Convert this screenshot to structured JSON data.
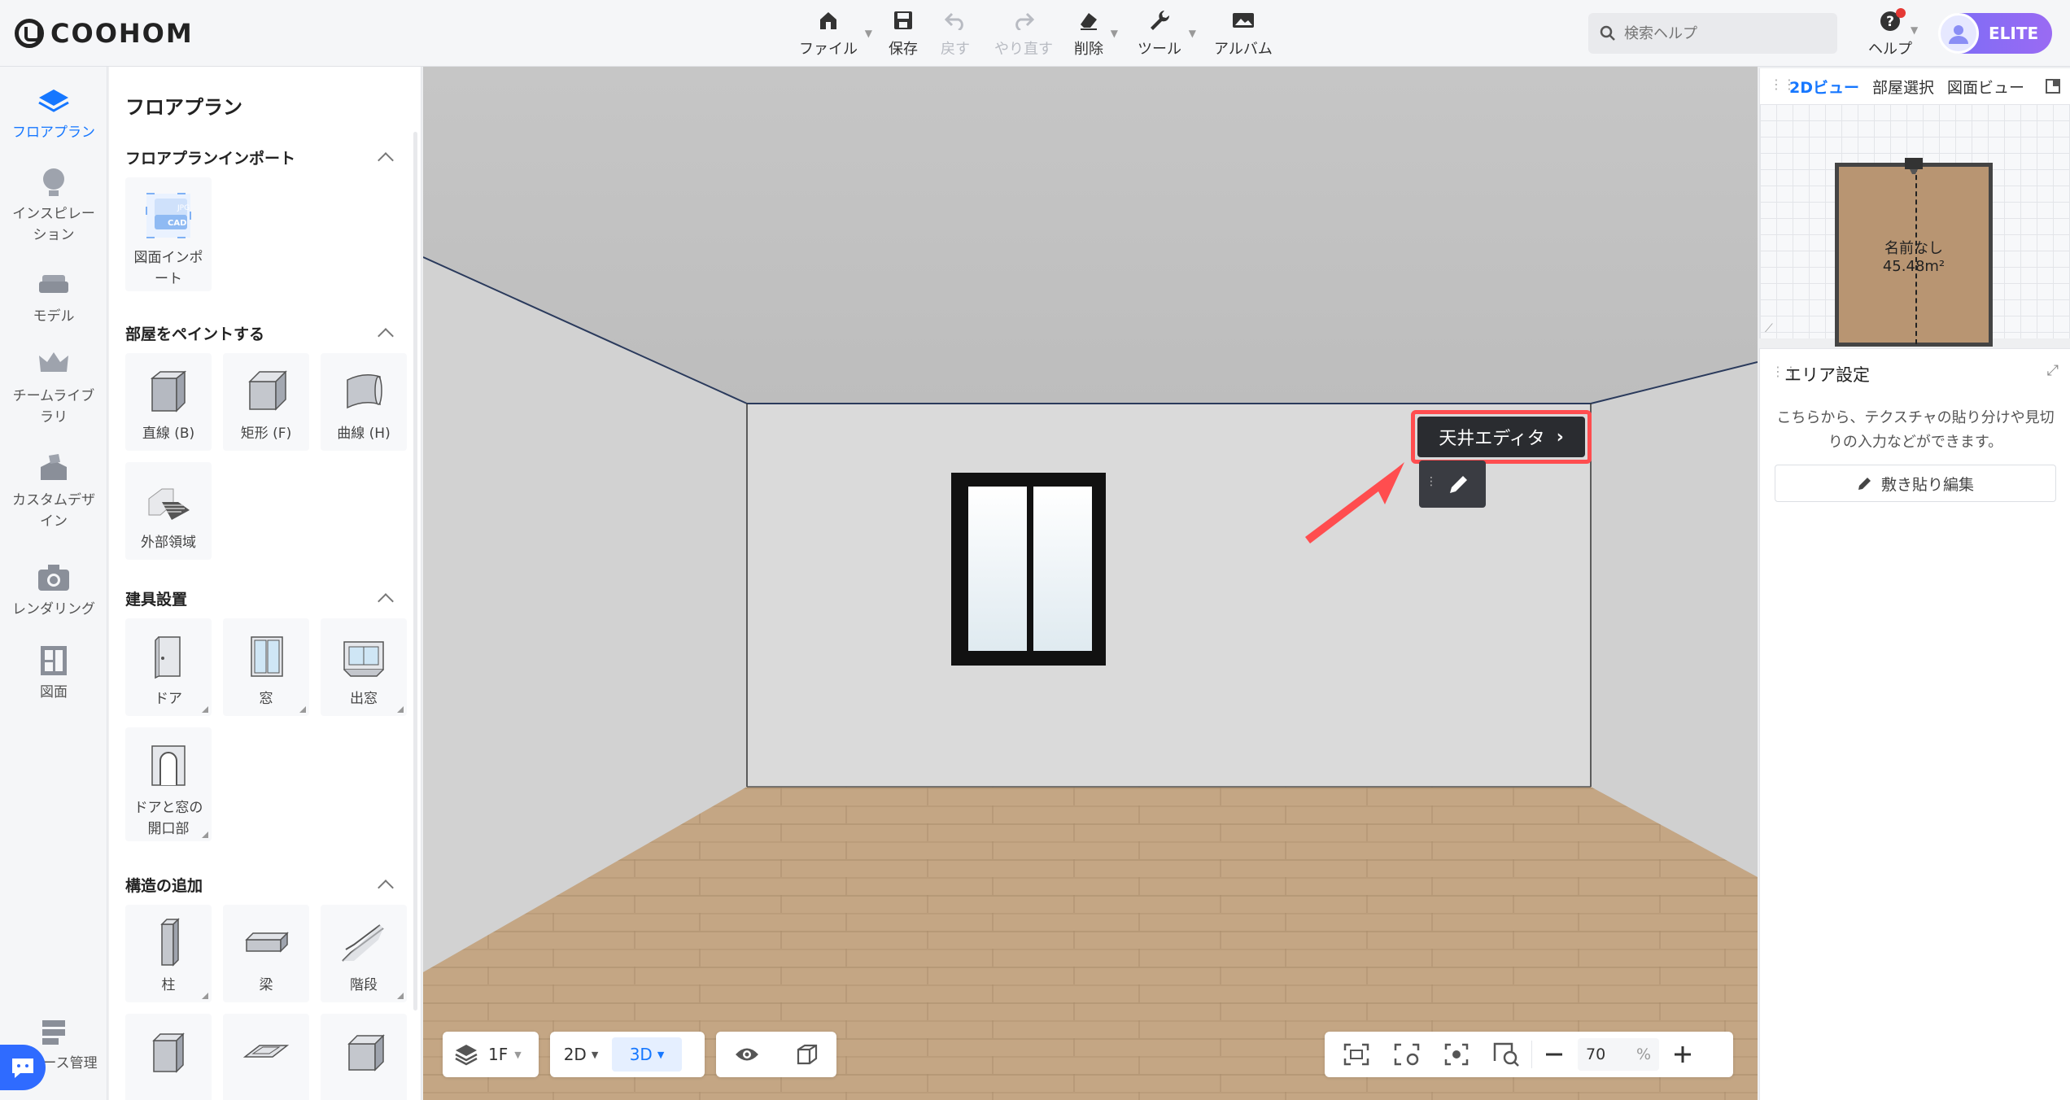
{
  "app": {
    "logo_text": "COOHOM"
  },
  "toolbar": {
    "file": "ファイル",
    "save": "保存",
    "undo": "戻す",
    "redo": "やり直す",
    "delete": "削除",
    "tools": "ツール",
    "album": "アルバム"
  },
  "search": {
    "placeholder": "検索ヘルプ"
  },
  "help": {
    "label": "ヘルプ"
  },
  "account": {
    "badge": "ELITE"
  },
  "rail": {
    "floorplan": "フロアプラン",
    "inspiration": "インスピレーション",
    "model": "モデル",
    "team_library": "チームライブラリ",
    "custom_design": "カスタムデザイン",
    "rendering": "レンダリング",
    "drawing": "図面",
    "resource_mgmt": "ース管理"
  },
  "panel": {
    "title": "フロアプラン",
    "import_section": "フロアプランインポート",
    "import_card": "図面インポート",
    "import_badges": [
      "JPG",
      "CAD"
    ],
    "paint_section": "部屋をペイントする",
    "paint_items": [
      "直線 (B)",
      "矩形 (F)",
      "曲線 (H)",
      "外部領域"
    ],
    "fixtures_section": "建具設置",
    "fixtures_items": [
      "ドア",
      "窓",
      "出窓",
      "ドアと窓の開口部"
    ],
    "structure_section": "構造の追加",
    "structure_items": [
      "柱",
      "梁",
      "階段"
    ]
  },
  "viewport": {
    "ceiling_editor_label": "天井エディタ",
    "floor_select": "1F",
    "view_2d": "2D",
    "view_3d": "3D",
    "zoom_value": "70",
    "zoom_unit": "%"
  },
  "minimap": {
    "tab_2d": "2Dビュー",
    "tab_room": "部屋選択",
    "tab_drawing": "図面ビュー",
    "room_name": "名前なし",
    "room_area": "45.48m²"
  },
  "area_settings": {
    "title": "エリア設定",
    "description": "こちらから、テクスチャの貼り分けや見切りの入力などができます。",
    "edit_button": "敷き貼り編集"
  },
  "colors": {
    "accent": "#1677ff",
    "highlight": "#ff4d4f",
    "elite": "#8a6cf5"
  }
}
